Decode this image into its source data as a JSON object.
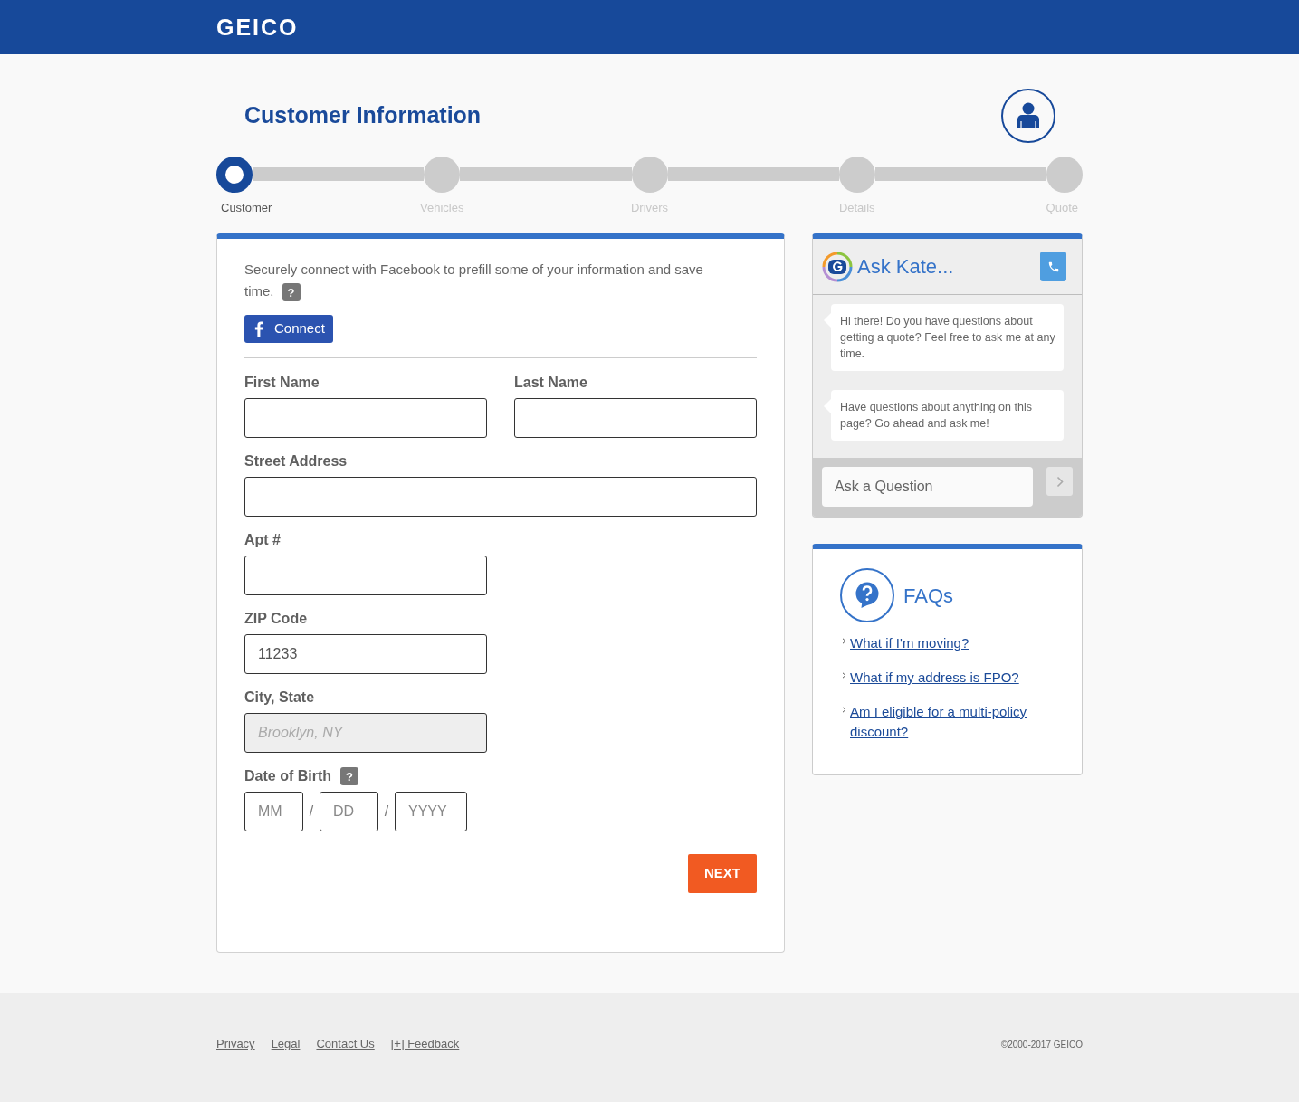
{
  "header": {
    "logo": "GEICO"
  },
  "page": {
    "title": "Customer Information"
  },
  "steps": [
    {
      "label": "Customer",
      "selected": true
    },
    {
      "label": "Vehicles",
      "selected": false
    },
    {
      "label": "Drivers",
      "selected": false
    },
    {
      "label": "Details",
      "selected": false
    },
    {
      "label": "Quote",
      "selected": false
    }
  ],
  "form": {
    "intro": "Securely connect with Facebook to prefill some of your information and save time.",
    "intro_help": "?",
    "connect_button": "Connect",
    "rows": [
      [
        {
          "kind": "text",
          "label": "First Name",
          "disabled": false
        },
        {
          "kind": "text",
          "label": "Last Name",
          "disabled": false
        }
      ],
      [
        {
          "kind": "long_text",
          "label": "Street Address",
          "disabled": false
        }
      ],
      [
        {
          "kind": "text",
          "label": "Apt #",
          "disabled": false
        }
      ],
      [
        {
          "kind": "text",
          "label": "ZIP Code",
          "value": "11233",
          "disabled": false
        }
      ],
      [
        {
          "kind": "text",
          "label": "City, State",
          "value": "Brooklyn, NY",
          "disabled": true
        }
      ],
      [
        {
          "kind": "date",
          "label": "Date of Birth",
          "help": "?",
          "disabled": false,
          "parts": [
            {
              "placeholder": "MM"
            },
            {
              "placeholder": "DD"
            },
            {
              "placeholder": "YYYY"
            }
          ],
          "separators": [
            "/",
            "/"
          ]
        }
      ]
    ],
    "next_button": "NEXT"
  },
  "chat": {
    "title": "Ask Kate...",
    "messages": [
      "Hi there! Do you have questions about getting a quote? Feel free to ask me at any time.",
      "Have questions about anything on this page? Go ahead and ask me!"
    ],
    "input": {
      "placeholder": "Ask a Question"
    }
  },
  "faq": {
    "title": "FAQs",
    "links": [
      "What if I'm moving?",
      "What if my address is FPO?",
      "Am I eligible for a multi-policy discount?"
    ]
  },
  "footer": {
    "links": [
      "Privacy",
      "Legal",
      "Contact Us",
      "[+] Feedback"
    ],
    "copyright": "©2000-2017 GEICO"
  }
}
